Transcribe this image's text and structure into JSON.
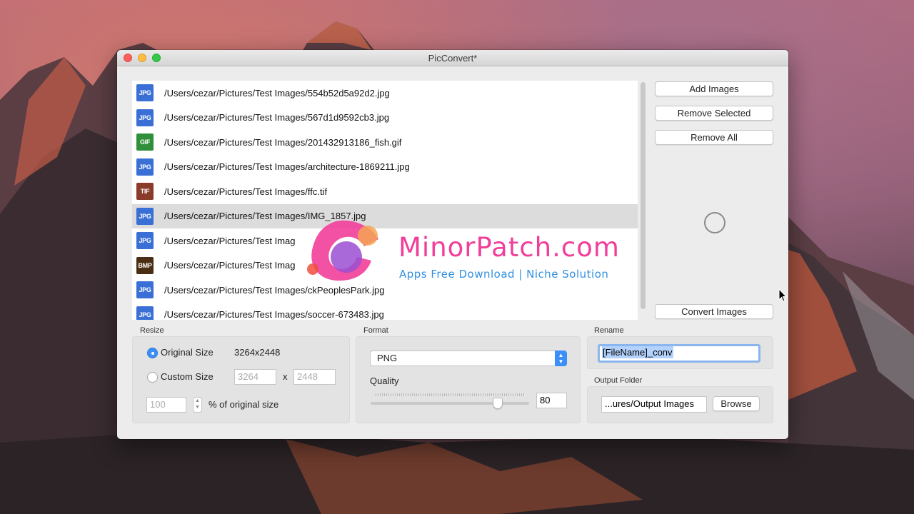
{
  "window": {
    "title": "PicConvert*"
  },
  "files": [
    {
      "type": "JPG",
      "color": "#3a6fd6",
      "path": "/Users/cezar/Pictures/Test Images/554b52d5a92d2.jpg",
      "selected": false
    },
    {
      "type": "JPG",
      "color": "#3a6fd6",
      "path": "/Users/cezar/Pictures/Test Images/567d1d9592cb3.jpg",
      "selected": false
    },
    {
      "type": "GIF",
      "color": "#2f8f3a",
      "path": "/Users/cezar/Pictures/Test Images/201432913186_fish.gif",
      "selected": false
    },
    {
      "type": "JPG",
      "color": "#3a6fd6",
      "path": "/Users/cezar/Pictures/Test Images/architecture-1869211.jpg",
      "selected": false
    },
    {
      "type": "TIF",
      "color": "#8a3b2a",
      "path": "/Users/cezar/Pictures/Test Images/ffc.tif",
      "selected": false
    },
    {
      "type": "JPG",
      "color": "#3a6fd6",
      "path": "/Users/cezar/Pictures/Test Images/IMG_1857.jpg",
      "selected": true
    },
    {
      "type": "JPG",
      "color": "#3a6fd6",
      "path": "/Users/cezar/Pictures/Test Imag",
      "selected": false
    },
    {
      "type": "BMP",
      "color": "#4a2e14",
      "path": "/Users/cezar/Pictures/Test Imag",
      "selected": false
    },
    {
      "type": "JPG",
      "color": "#3a6fd6",
      "path": "/Users/cezar/Pictures/Test Images/ckPeoplesPark.jpg",
      "selected": false
    },
    {
      "type": "JPG",
      "color": "#3a6fd6",
      "path": "/Users/cezar/Pictures/Test Images/soccer-673483.jpg",
      "selected": false
    }
  ],
  "buttons": {
    "add_images": "Add Images",
    "remove_selected": "Remove Selected",
    "remove_all": "Remove All",
    "convert_images": "Convert Images",
    "browse": "Browse"
  },
  "resize": {
    "label": "Resize",
    "original_size_label": "Original Size",
    "original_size_value": "3264x2448",
    "custom_size_label": "Custom Size",
    "custom_width": "3264",
    "custom_height": "2448",
    "times": "x",
    "percent_value": "100",
    "percent_label": "% of original size",
    "selected": "original"
  },
  "format": {
    "label": "Format",
    "selected": "PNG",
    "quality_label": "Quality",
    "quality_value": "80",
    "quality_level": 80
  },
  "rename": {
    "label": "Rename",
    "value": "[FileName]_conv"
  },
  "output": {
    "label": "Output Folder",
    "value": "...ures/Output Images"
  },
  "watermark": {
    "title": "MinorPatch.com",
    "subtitle": "Apps Free Download | Niche Solution"
  },
  "colors": {
    "accent": "#3b8ff7",
    "watermark_pink": "#f13e9a",
    "watermark_blue": "#2f8fe0"
  }
}
